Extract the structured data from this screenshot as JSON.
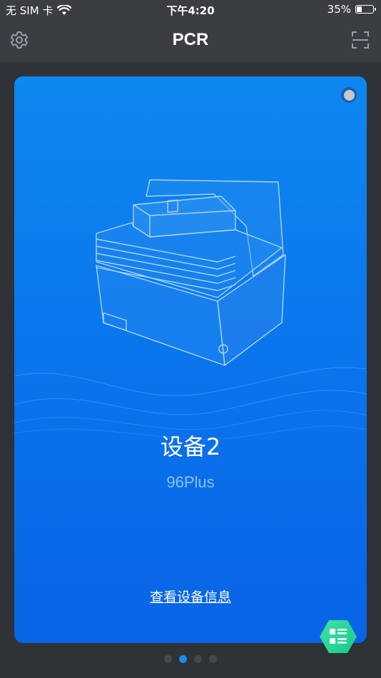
{
  "status_bar": {
    "carrier": "无 SIM 卡",
    "time": "下午4:20",
    "battery_percent": "35%",
    "battery_level": 0.35,
    "wifi_icon": "wifi-icon"
  },
  "nav": {
    "title": "PCR",
    "left_icon": "gear-icon",
    "right_icon": "scan-icon"
  },
  "device_card": {
    "name": "设备2",
    "model": "96Plus",
    "info_link": "查看设备信息",
    "connection_icon": "status-dot-icon"
  },
  "pager": {
    "pages": 4,
    "active_index": 1
  },
  "fab": {
    "icon": "list-icon"
  },
  "colors": {
    "header_bg": "#3a3d42",
    "page_bg": "#2f3236",
    "card_top": "#0d88f0",
    "card_bottom": "#0764e6",
    "fab_green": "#27d79a",
    "pager_active": "#1a8cf0"
  }
}
